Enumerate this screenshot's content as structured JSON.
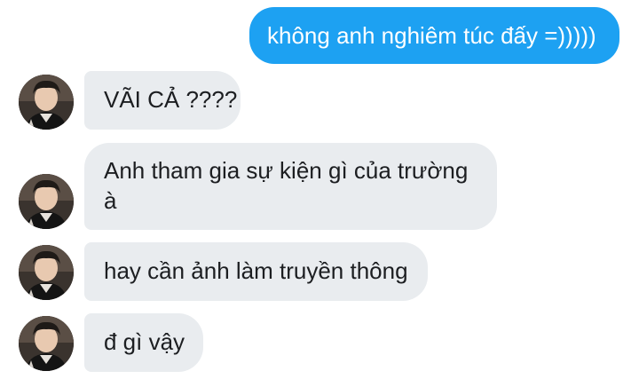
{
  "colors": {
    "outgoing_bubble": "#1da1f2",
    "incoming_bubble": "#e9ecef",
    "incoming_text": "#1c1e21",
    "outgoing_text": "#ffffff"
  },
  "messages": [
    {
      "direction": "outgoing",
      "text": "không anh nghiêm túc đấy =)))))"
    },
    {
      "direction": "incoming",
      "text": "VÃI CẢ ????"
    },
    {
      "direction": "incoming",
      "text": "Anh tham gia sự kiện gì của trường à"
    },
    {
      "direction": "incoming",
      "text": "hay cần ảnh làm truyền thông"
    },
    {
      "direction": "incoming",
      "text": "đ gì vậy"
    }
  ],
  "avatar_icon": "contact-avatar-photo"
}
